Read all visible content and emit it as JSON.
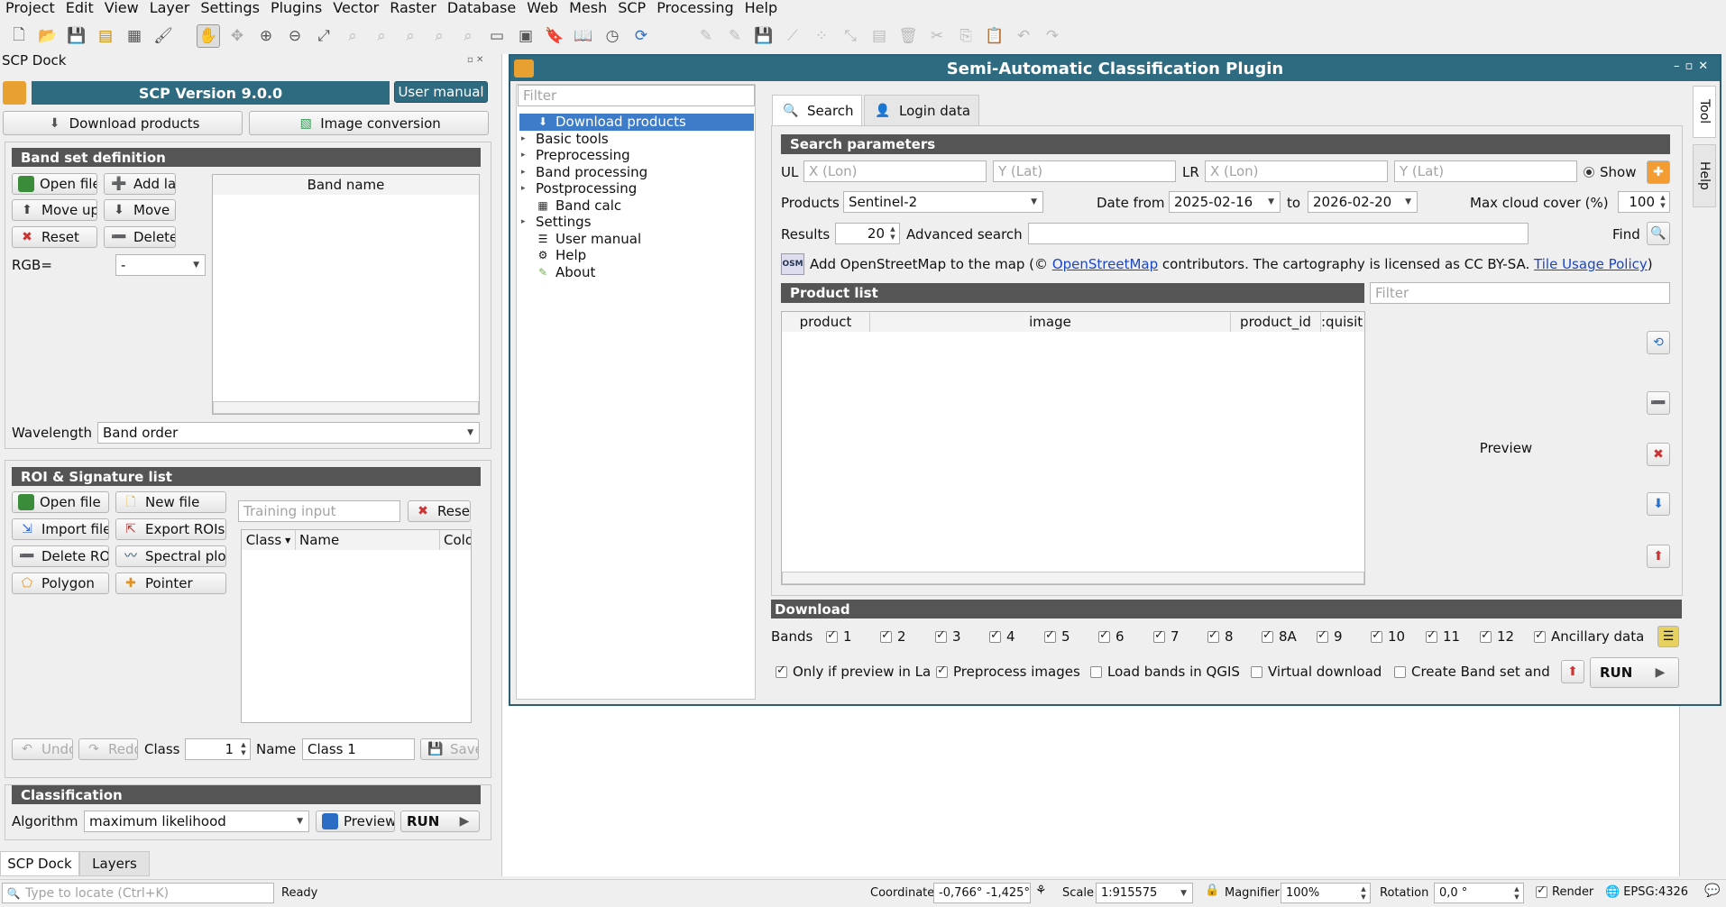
{
  "menubar": [
    "Project",
    "Edit",
    "View",
    "Layer",
    "Settings",
    "Plugins",
    "Vector",
    "Raster",
    "Database",
    "Web",
    "Mesh",
    "SCP",
    "Processing",
    "Help"
  ],
  "dock": {
    "title": "SCP Dock",
    "version": "SCP Version 9.0.0",
    "user_manual": "User manual",
    "download_products": "Download products",
    "image_conversion": "Image conversion",
    "band_set": {
      "title": "Band set definition",
      "open_file": "Open file",
      "add_layer": "Add layer",
      "move_up": "Move up",
      "move_down": "Move down",
      "reset": "Reset",
      "delete_row": "Delete row",
      "rgb_label": "RGB=",
      "rgb_value": "-",
      "band_name_col": "Band name",
      "wavelength_label": "Wavelength",
      "wavelength_value": "Band order"
    },
    "roi": {
      "title": "ROI & Signature list",
      "open_file": "Open file",
      "new_file": "New file",
      "training_placeholder": "Training input",
      "reset": "Reset",
      "import_file": "Import file",
      "export_rois": "Export ROIs",
      "delete_roi": "Delete ROI",
      "spectral_plot": "Spectral plot",
      "polygon": "Polygon",
      "pointer": "Pointer",
      "col_class": "Class",
      "col_name": "Name",
      "col_color": "Colo",
      "undo": "Undo",
      "redo": "Redo",
      "class_label": "Class",
      "class_value": "1",
      "name_label": "Name",
      "name_value": "Class 1",
      "save": "Save"
    },
    "classification": {
      "title": "Classification",
      "algorithm_label": "Algorithm",
      "algorithm_value": "maximum likelihood",
      "preview": "Preview",
      "run": "RUN"
    },
    "tabs": [
      "SCP Dock",
      "Layers"
    ]
  },
  "plugin": {
    "title": "Semi-Automatic Classification Plugin",
    "filter_placeholder": "Filter",
    "tree": [
      {
        "label": "Download products",
        "arrow": "",
        "selected": true
      },
      {
        "label": "Basic tools",
        "arrow": "▸"
      },
      {
        "label": "Preprocessing",
        "arrow": "▸"
      },
      {
        "label": "Band processing",
        "arrow": "▸"
      },
      {
        "label": "Postprocessing",
        "arrow": "▸"
      },
      {
        "label": "Band calc",
        "arrow": ""
      },
      {
        "label": "Settings",
        "arrow": "▸"
      },
      {
        "label": "User manual",
        "arrow": ""
      },
      {
        "label": "Help",
        "arrow": ""
      },
      {
        "label": "About",
        "arrow": ""
      }
    ],
    "tabs": {
      "search": "Search",
      "login": "Login data"
    },
    "side_tabs": [
      "Tool",
      "Help"
    ],
    "search_params": {
      "title": "Search parameters",
      "ul": "UL",
      "lr": "LR",
      "x_lon": "X (Lon)",
      "y_lat": "Y (Lat)",
      "show": "Show",
      "products_label": "Products",
      "products_value": "Sentinel-2",
      "date_from_label": "Date from",
      "date_from": "2025-02-16",
      "to_label": "to",
      "date_to": "2026-02-20",
      "max_cloud_label": "Max cloud cover (%)",
      "max_cloud": "100",
      "results_label": "Results",
      "results": "20",
      "advanced_label": "Advanced search",
      "find_label": "Find",
      "osm_prefix": "Add OpenStreetMap to the map (©",
      "osm_link": "OpenStreetMap",
      "osm_middle": "contributors. The cartography is licensed as CC BY-SA.",
      "osm_policy": "Tile Usage Policy",
      "osm_suffix": ")"
    },
    "product_list": {
      "title": "Product list",
      "filter_placeholder": "Filter",
      "columns": [
        "product",
        "image",
        "product_id",
        ":quisit"
      ],
      "preview": "Preview"
    },
    "download": {
      "title": "Download",
      "bands_label": "Bands",
      "bands": [
        "1",
        "2",
        "3",
        "4",
        "5",
        "6",
        "7",
        "8",
        "8A",
        "9",
        "10",
        "11",
        "12"
      ],
      "ancillary": "Ancillary data",
      "only_preview": "Only if preview in La",
      "preprocess": "Preprocess images",
      "load_bands": "Load bands in QGIS",
      "virtual": "Virtual download",
      "create_bandset": "Create Band set and",
      "run": "RUN"
    }
  },
  "statusbar": {
    "locate_placeholder": "Type to locate (Ctrl+K)",
    "ready": "Ready",
    "coordinate_label": "Coordinate",
    "coordinate_value": "-0,766° -1,425°",
    "scale_label": "Scale",
    "scale_value": "1:915575",
    "magnifier_label": "Magnifier",
    "magnifier_value": "100%",
    "rotation_label": "Rotation",
    "rotation_value": "0,0 °",
    "render_label": "Render",
    "crs": "EPSG:4326"
  }
}
